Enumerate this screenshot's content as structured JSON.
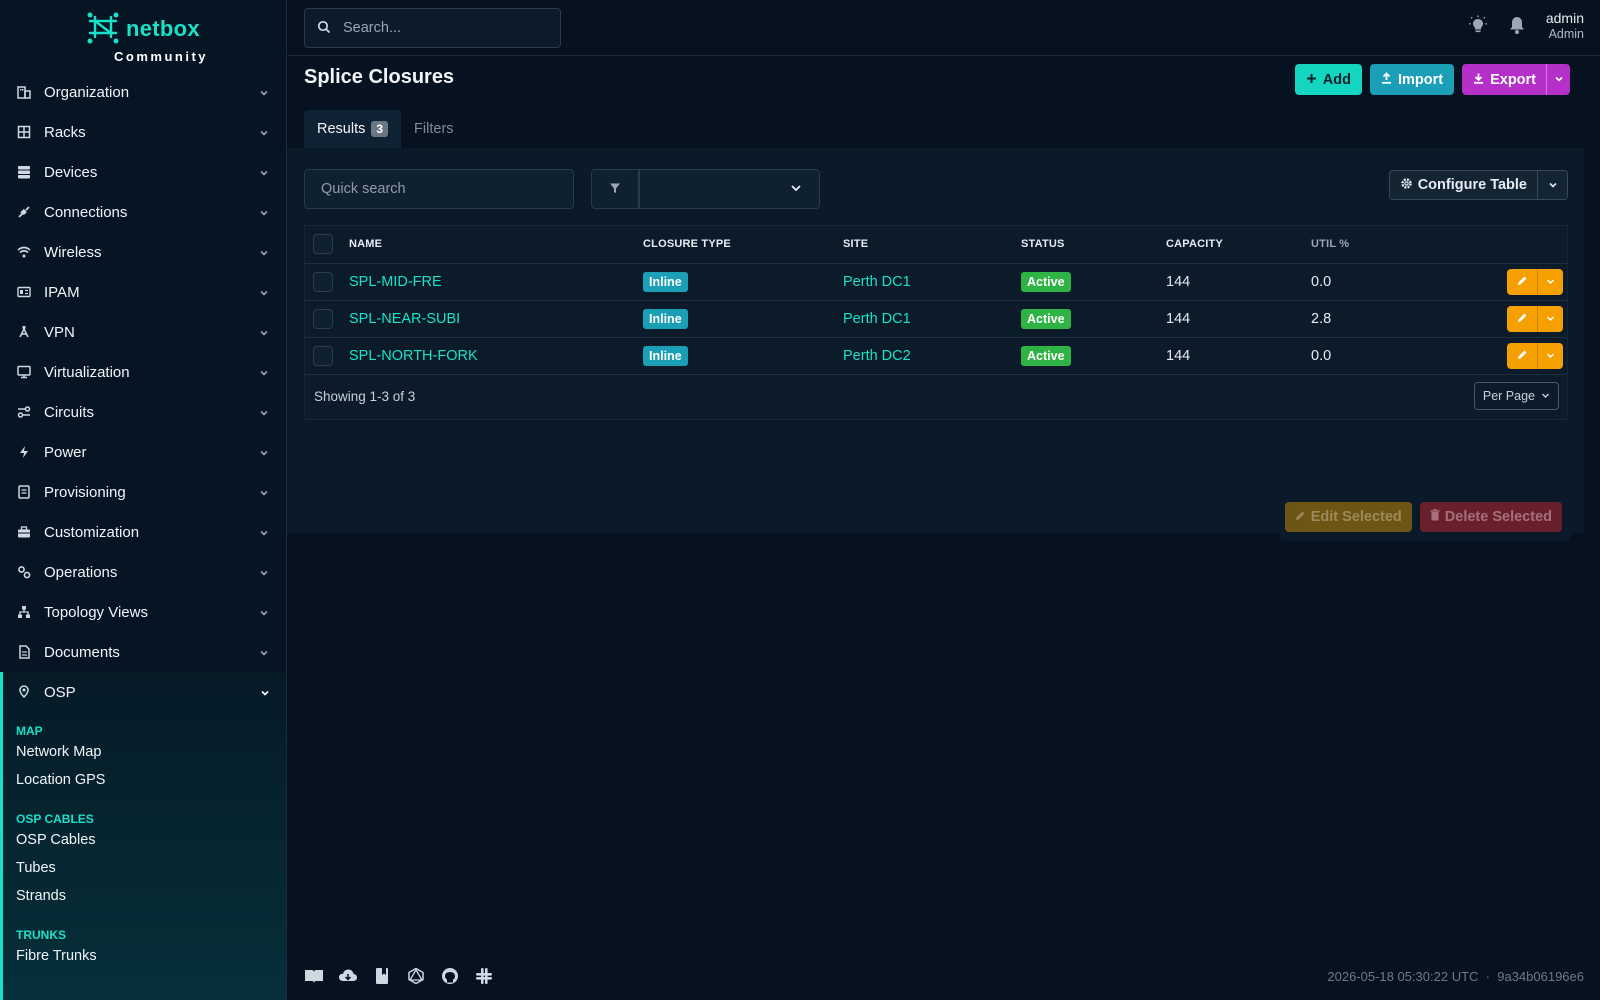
{
  "brand": {
    "name": "netbox",
    "sub": "Community"
  },
  "search": {
    "placeholder": "Search..."
  },
  "user": {
    "name": "admin",
    "role": "Admin"
  },
  "nav": [
    {
      "label": "Organization",
      "icon": "organization-icon"
    },
    {
      "label": "Racks",
      "icon": "rack-icon"
    },
    {
      "label": "Devices",
      "icon": "server-icon"
    },
    {
      "label": "Connections",
      "icon": "plug-icon"
    },
    {
      "label": "Wireless",
      "icon": "wifi-icon"
    },
    {
      "label": "IPAM",
      "icon": "ip-icon"
    },
    {
      "label": "VPN",
      "icon": "vpn-icon"
    },
    {
      "label": "Virtualization",
      "icon": "monitor-icon"
    },
    {
      "label": "Circuits",
      "icon": "circuit-icon"
    },
    {
      "label": "Power",
      "icon": "power-icon"
    },
    {
      "label": "Provisioning",
      "icon": "provisioning-icon"
    },
    {
      "label": "Customization",
      "icon": "toolbox-icon"
    },
    {
      "label": "Operations",
      "icon": "cogs-icon"
    },
    {
      "label": "Topology Views",
      "icon": "topology-icon"
    },
    {
      "label": "Documents",
      "icon": "document-icon"
    }
  ],
  "osp": {
    "label": "OSP",
    "groups": [
      {
        "heading": "MAP",
        "items": [
          "Network Map",
          "Location GPS"
        ]
      },
      {
        "heading": "OSP CABLES",
        "items": [
          "OSP Cables",
          "Tubes",
          "Strands"
        ]
      },
      {
        "heading": "TRUNKS",
        "items": [
          "Fibre Trunks"
        ]
      }
    ]
  },
  "page": {
    "title": "Splice Closures",
    "add_label": "Add",
    "import_label": "Import",
    "export_label": "Export",
    "tab_results": "Results",
    "tab_results_count": "3",
    "tab_filters": "Filters",
    "quick_search_placeholder": "Quick search",
    "configure_table": "Configure Table"
  },
  "table": {
    "headers": {
      "name": "NAME",
      "closure_type": "CLOSURE TYPE",
      "site": "SITE",
      "status": "STATUS",
      "capacity": "CAPACITY",
      "util": "UTIL %"
    },
    "rows": [
      {
        "name": "SPL-MID-FRE",
        "closure_type": "Inline",
        "site": "Perth DC1",
        "status": "Active",
        "capacity": "144",
        "util": "0.0"
      },
      {
        "name": "SPL-NEAR-SUBI",
        "closure_type": "Inline",
        "site": "Perth DC1",
        "status": "Active",
        "capacity": "144",
        "util": "2.8"
      },
      {
        "name": "SPL-NORTH-FORK",
        "closure_type": "Inline",
        "site": "Perth DC2",
        "status": "Active",
        "capacity": "144",
        "util": "0.0"
      }
    ],
    "showing": "Showing 1-3 of 3",
    "per_page": "Per Page"
  },
  "bulk": {
    "edit_label": "Edit Selected",
    "delete_label": "Delete Selected"
  },
  "footer": {
    "timestamp": "2026-05-18 05:30:22 UTC",
    "separator": "·",
    "commit": "9a34b06196e6"
  },
  "colors": {
    "accent": "#19e0c8",
    "info": "#1b9fb6",
    "success": "#2fb344",
    "warning": "#f59f00",
    "export": "#b52fc9"
  }
}
